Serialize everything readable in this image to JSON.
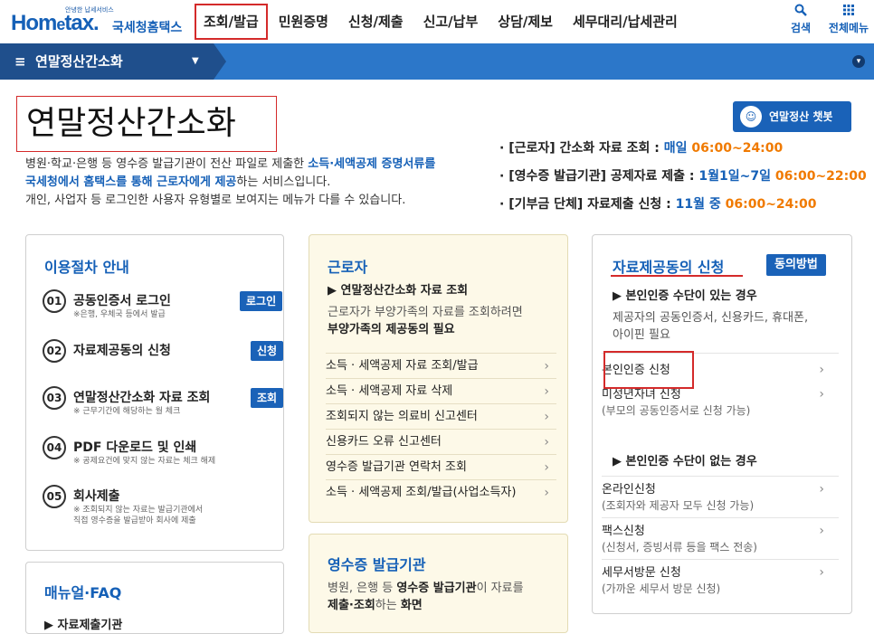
{
  "header": {
    "logo_small": "안녕한 납세서비스",
    "logo_home": "Hom",
    "logo_e": "e",
    "logo_tax": "tax.",
    "logo_kr": "국세청홈택스",
    "gnb": [
      "조회/발급",
      "민원증명",
      "신청/제출",
      "신고/납부",
      "상담/제보",
      "세무대리/납세관리"
    ],
    "search_label": "검색",
    "allmenu_label": "전체메뉴"
  },
  "subbar": {
    "menu_label": "연말정산간소화"
  },
  "page": {
    "title": "연말정산간소화",
    "chatbot_label": "연말정산 챗봇",
    "intro_1a": "병원·학교·은행 등 영수증 발급기관이 전산 파일로 제출한 ",
    "intro_1b": "소득·세액공제 증명서류를",
    "intro_2a": "국세청에서 홈택스를 통해 근로자에게 제공",
    "intro_2b": "하는 서비스입니다.",
    "intro_3": "개인, 사업자 등 로그인한 사용자 유형별로 보여지는 메뉴가 다를 수 있습니다."
  },
  "schedule": [
    {
      "label": "· [근로자] 간소화 자료 조회 : ",
      "period": "매일 ",
      "time": "06:00~24:00"
    },
    {
      "label": "· [영수증 발급기관] 공제자료 제출 : ",
      "period": "1월1일~7일 ",
      "time": "06:00~22:00"
    },
    {
      "label": "· [기부금 단체] 자료제출 신청 : ",
      "period": "11월 중 ",
      "time": "06:00~24:00"
    }
  ],
  "procedure": {
    "title": "이용절차 안내",
    "steps": [
      {
        "num": "01",
        "title": "공동인증서 로그인",
        "note": "※은행, 우체국 등에서 발급",
        "note2": "",
        "button": "로그인"
      },
      {
        "num": "02",
        "title": "자료제공동의 신청",
        "note": "",
        "note2": "",
        "button": "신청"
      },
      {
        "num": "03",
        "title": "연말정산간소화 자료 조회",
        "note": "※ 근무기간에 해당하는 월 체크",
        "note2": "",
        "button": "조회"
      },
      {
        "num": "04",
        "title": "PDF 다운로드 및 인쇄",
        "note": "※ 공제요건에 맞지 않는 자료는 체크 해제",
        "note2": "",
        "button": ""
      },
      {
        "num": "05",
        "title": "회사제출",
        "note": "※ 조회되지 않는 자료는 발급기관에서",
        "note2": "직접 영수증을 발급받아 회사에 제출",
        "button": ""
      }
    ]
  },
  "worker": {
    "title": "근로자",
    "subhead": "▶ 연말정산간소화 자료 조회",
    "desc_1": "근로자가 부양가족의 자료를 조회하려면",
    "desc_2": "부양가족의 제공동의 필요",
    "links": [
      "소득 · 세액공제 자료 조회/발급",
      "소득 · 세액공제 자료 삭제",
      "조회되지 않는 의료비 신고센터",
      "신용카드 오류 신고센터",
      "영수증 발급기관 연락처 조회",
      "소득 · 세액공제 조회/발급(사업소득자)"
    ]
  },
  "consent": {
    "title": "자료제공동의 신청",
    "button": "동의방법",
    "sub1": "▶ 본인인증 수단이 있는 경우",
    "desc_1": "제공자의 공동인증서, 신용카드, 휴대폰,",
    "desc_2": "아이핀 필요",
    "links1": [
      {
        "t": "본인인증 신청",
        "s": ""
      },
      {
        "t": "미성년자녀 신청",
        "s": "(부모의 공동인증서로 신청 가능)"
      }
    ],
    "sub2": "▶ 본인인증 수단이 없는 경우",
    "links2": [
      {
        "t": "온라인신청",
        "s": "(조회자와 제공자 모두 신청 가능)"
      },
      {
        "t": "팩스신청",
        "s": "(신청서, 증빙서류 등을 팩스 전송)"
      },
      {
        "t": "세무서방문 신청",
        "s": "(가까운 세무서 방문 신청)"
      }
    ]
  },
  "manual": {
    "title": "매뉴얼·FAQ",
    "item": "▶ 자료제출기관"
  },
  "issuer": {
    "title": "영수증 발급기관",
    "desc_1a": "병원, 은행 등 ",
    "desc_1b": "영수증 발급기관",
    "desc_1c": "이 자료를",
    "desc_2a": "제출·조회",
    "desc_2b": "하는 ",
    "desc_2c": "화면"
  },
  "icons": {
    "search": "magnifier-icon",
    "allmenu": "grid-icon",
    "chevron": "›"
  }
}
